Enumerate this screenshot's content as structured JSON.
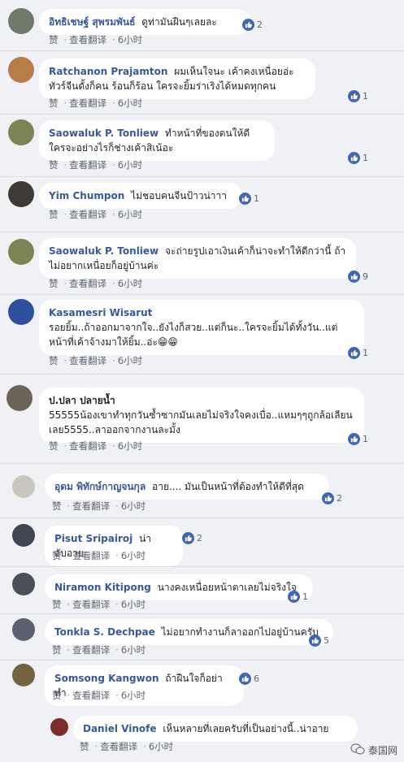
{
  "actions": {
    "like": "赞",
    "translate": "查看翻译",
    "time": "6小时"
  },
  "comments": [
    {
      "author": "อิทธิเชษฐ์ สุพรมพันธ์",
      "text": "ดูท่ามันฝืนๆเลยละ",
      "likes": "2"
    },
    {
      "author": "Ratchanon Prajamton",
      "text": "ผมเห็นใจนะ เค้าคงเหนื่อยอ่ะ ทัวร์จีนดั้งก็คน ร้อนก็ร้อน ใครจะยิ้มร่าเริงได้หมดทุกคน",
      "likes": "1"
    },
    {
      "author": "Saowaluk P. Tonliew",
      "text": "ทำหน้าที่ของตนให้ดี ใครจะอย่างไรก็ช่างเค้าสิเน้อะ",
      "likes": "1"
    },
    {
      "author": "Yim Chumpon",
      "text": "ไม่ชอบคนจีนป้าวน่าาา",
      "likes": "1"
    },
    {
      "author": "Saowaluk P. Tonliew",
      "text": "จะถ่ายรูปเอาเงินเค้าก็น่าจะทำให้ดีกว่านี้ ถ้าไม่อยากเหนื่อยก็อยู่บ้านค่ะ",
      "likes": "9"
    },
    {
      "author": "Kasamesri Wisarut",
      "text": "รอยยิ้ม..ถ้าออกมาจากใจ..ยังไงก็สวย..แต่ก็นะ..ใครจะยิ้มได้ทั้งวัน..แต่หน้าที่เค้าจ้างมาให้ยิ้ม..อ่ะ😁😁",
      "likes": "1"
    },
    {
      "author": "ป.ปลา ปลายน้ำ",
      "text": "55555น้องเขาทำทุกวันซ้ำซากมันเลยไม่จริงใจคงเบื่อ..แหมๆๆถูกล้อเลียนเลย5555..ลาออกจากงานละมั้ง",
      "likes": "1"
    },
    {
      "author": "อุดม พิทักษ์กาญจนกุล",
      "text": "อาย.... มันเป็นหน้าที่ต้องทำให้ดีที่สุด",
      "likes": "2"
    },
    {
      "author": "Pisut Sripairoj",
      "text": "น่าอับอาย",
      "likes": "2"
    },
    {
      "author": "Niramon Kitipong",
      "text": "นางคงเหนื่อยหน้าตาเลยไม่จริงใจ",
      "likes": "1"
    },
    {
      "author": "Tonkla S. Dechpae",
      "text": "ไม่อยากทำงานก็ลาออกไปอยู่บ้านครับ",
      "likes": "5"
    },
    {
      "author": "Somsong Kangwon",
      "text": "ถ้าฝืนใจก็อย่าทำ",
      "likes": "6"
    },
    {
      "author": "Daniel Vinofe",
      "text": "เห็นหลายที่เลยครับที่เป็นอย่างนี้..น่าอาย",
      "likes": ""
    }
  ],
  "watermark": "泰国网",
  "colors": {
    "author": "#385898",
    "like": "#4267b2",
    "bubble": "#ffffff",
    "background": "#f0f1f4"
  },
  "icons": {
    "like": "thumbs-up-icon",
    "watermark": "wechat-logo-icon"
  }
}
